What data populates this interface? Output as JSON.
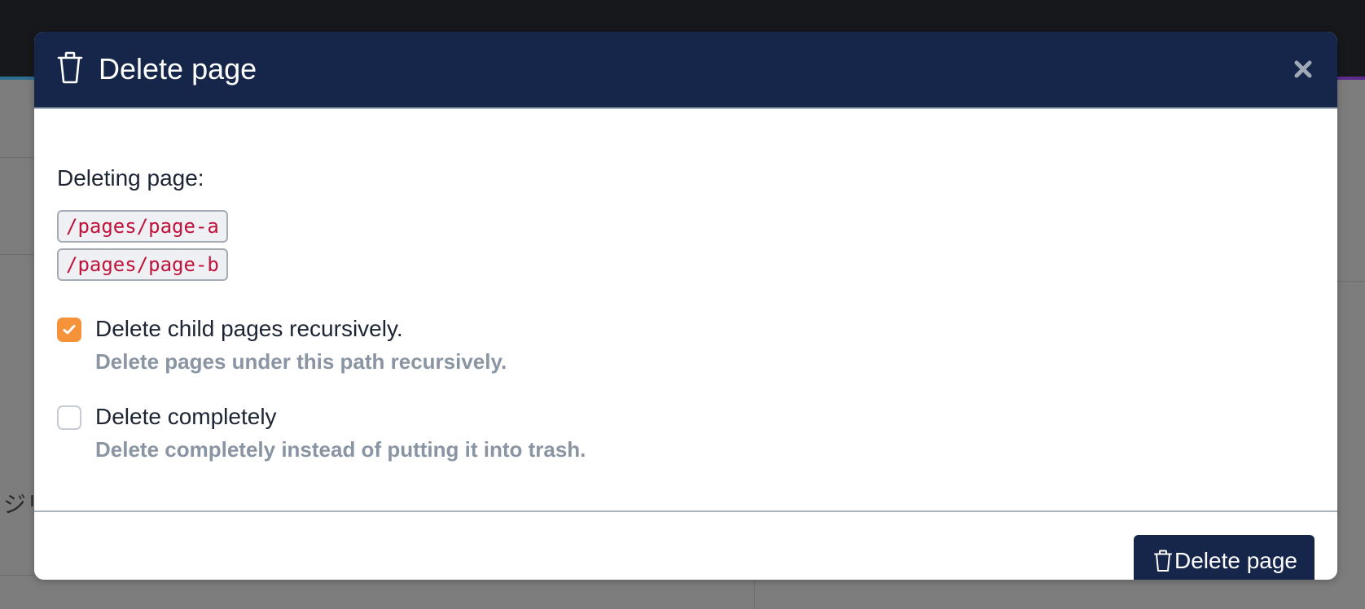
{
  "background": {
    "partial_text": "ジリ"
  },
  "modal": {
    "title": "Delete page",
    "header_icon": "trash-icon",
    "close_icon": "close-icon",
    "deleting_label": "Deleting page:",
    "paths": [
      "/pages/page-a",
      "/pages/page-b"
    ],
    "options": [
      {
        "label": "Delete child pages recursively.",
        "help": "Delete pages under this path recursively.",
        "checked": true
      },
      {
        "label": "Delete completely",
        "help": "Delete completely instead of putting it into trash.",
        "checked": false
      }
    ],
    "submit_label": "Delete page",
    "submit_icon": "trash-icon"
  },
  "colors": {
    "header_bg": "#15264a",
    "checkbox_checked": "#f5923a",
    "path_text": "#c0143c",
    "help_text": "#8a95a3"
  }
}
